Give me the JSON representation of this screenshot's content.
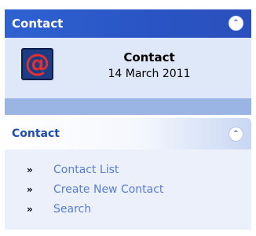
{
  "colors": {
    "header_blue": "#2a54c4",
    "pane_light": "#dfe8f8",
    "pane_separator": "#9ab4e4",
    "link_color": "#5a7ed0",
    "section_title": "#1e4cb2",
    "icon_background": "#1d3c86",
    "icon_at": "#e03030"
  },
  "top_pane": {
    "title": "Contact",
    "collapse_icon": "double-chevron-up-icon",
    "collapse_glyph": "⌃",
    "info": {
      "icon": "mail-at-icon",
      "icon_glyph": "@",
      "title": "Contact",
      "date": "14 March 2011"
    }
  },
  "task_pane": {
    "title": "Contact",
    "collapse_icon": "double-chevron-up-icon",
    "collapse_glyph": "⌃",
    "bullet_icon": "double-chevron-right-icon",
    "bullet_glyph": "»",
    "links": [
      {
        "label": "Contact List"
      },
      {
        "label": "Create New Contact"
      },
      {
        "label": "Search"
      }
    ]
  }
}
